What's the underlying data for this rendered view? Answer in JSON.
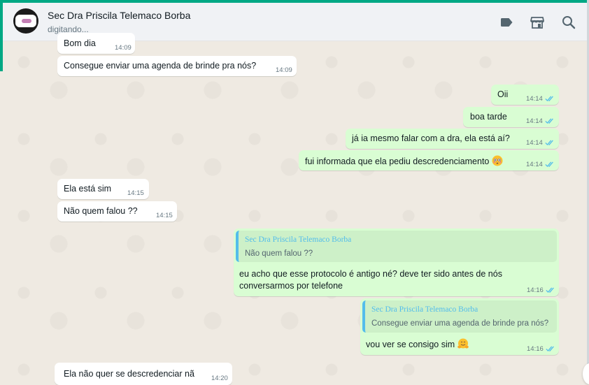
{
  "header": {
    "name": "Sec Dra Priscila Telemaco Borba",
    "status": "digitando...",
    "icons": [
      "label-icon",
      "store-icon",
      "search-icon"
    ]
  },
  "messages": [
    {
      "dir": "in",
      "text": "Bom dia",
      "time": "14:09"
    },
    {
      "dir": "in",
      "text": "Consegue enviar uma agenda de brinde pra nós?",
      "time": "14:09"
    },
    {
      "dir": "out",
      "text": "Oii",
      "time": "14:14",
      "read": true
    },
    {
      "dir": "out",
      "text": "boa tarde",
      "time": "14:14",
      "read": true
    },
    {
      "dir": "out",
      "text": "já ia mesmo falar com a dra, ela está aí?",
      "time": "14:14",
      "read": true
    },
    {
      "dir": "out",
      "text": "fui informada que ela pediu descredenciamento",
      "emoji": "flushed-face",
      "time": "14:14",
      "read": true
    },
    {
      "dir": "in",
      "text": "Ela está sim",
      "time": "14:15"
    },
    {
      "dir": "in",
      "text": "Não quem falou ??",
      "time": "14:15"
    },
    {
      "dir": "out",
      "quote_author": "Sec Dra Priscila Telemaco Borba",
      "quote_text": "Não quem falou ??",
      "text_line1": "eu acho que esse protocolo é antigo né? deve ter sido antes de nós",
      "text_line2": "conversarmos por telefone",
      "time": "14:16",
      "read": true
    },
    {
      "dir": "out",
      "quote_author": "Sec Dra Priscila Telemaco Borba",
      "quote_text": "Consegue enviar uma agenda de brinde pra nós?",
      "text": "vou ver se consigo sim",
      "emoji": "hugging-face",
      "time": "14:16",
      "read": true
    },
    {
      "dir": "in",
      "text": "Ela não quer se descredenciar nã",
      "time": "14:20"
    }
  ],
  "colors": {
    "accent": "#00a884",
    "incoming": "#ffffff",
    "outgoing": "#d9fdd3",
    "read_tick": "#53bdeb",
    "wallpaper": "#efeae2"
  }
}
